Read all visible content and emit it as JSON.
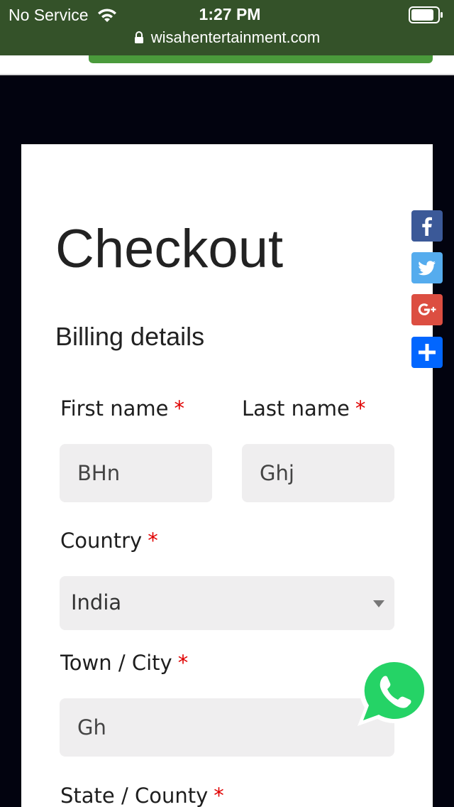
{
  "status_bar": {
    "carrier": "No Service",
    "time": "1:27 PM",
    "url": "wisahentertainment.com"
  },
  "checkout": {
    "title": "Checkout",
    "section": "Billing details",
    "required_mark": "*",
    "first_name": {
      "label": "First name",
      "value": "BHn"
    },
    "last_name": {
      "label": "Last name",
      "value": "Ghj"
    },
    "country": {
      "label": "Country",
      "value": "India"
    },
    "town": {
      "label": "Town / City",
      "value": "Gh"
    },
    "state": {
      "label": "State / County"
    }
  },
  "share": {
    "icons": [
      "facebook-icon",
      "twitter-icon",
      "google-plus-icon",
      "add-share-icon"
    ],
    "colors": {
      "facebook": "#3b5998",
      "twitter": "#55acee",
      "google_plus": "#dc4e41",
      "add": "#0166ff"
    }
  },
  "colors": {
    "required": "#e00000",
    "field_bg": "#efeeef",
    "header_green": "#4a9a3b",
    "whatsapp": "#25d366"
  }
}
